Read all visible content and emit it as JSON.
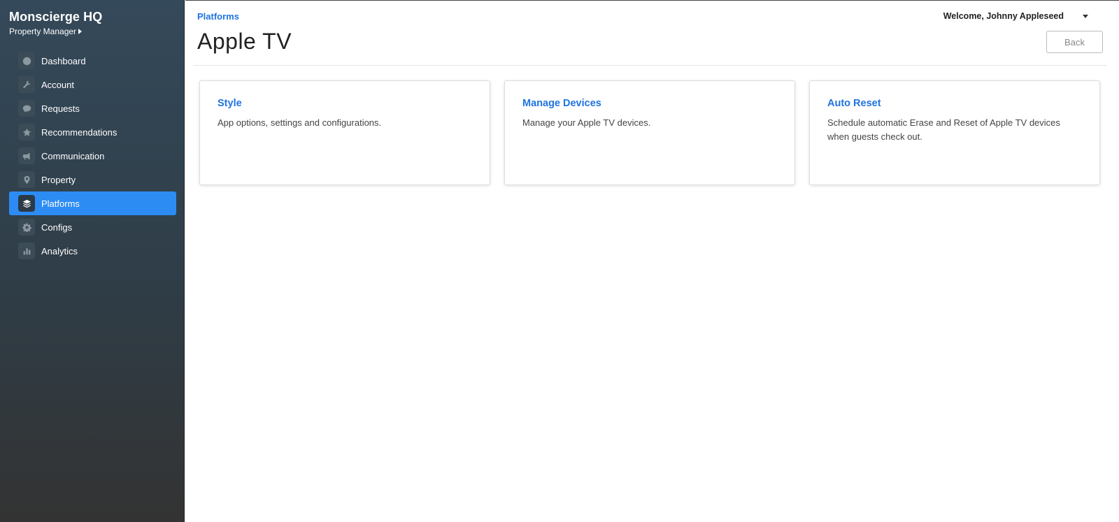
{
  "sidebar": {
    "brand": "Monscierge HQ",
    "role": "Property Manager",
    "items": [
      {
        "label": "Dashboard",
        "icon": "dashboard-icon"
      },
      {
        "label": "Account",
        "icon": "wrench-icon"
      },
      {
        "label": "Requests",
        "icon": "chat-bubble-icon"
      },
      {
        "label": "Recommendations",
        "icon": "star-icon"
      },
      {
        "label": "Communication",
        "icon": "megaphone-icon"
      },
      {
        "label": "Property",
        "icon": "map-pin-icon"
      },
      {
        "label": "Platforms",
        "icon": "layers-icon",
        "active": true
      },
      {
        "label": "Configs",
        "icon": "gear-icon"
      },
      {
        "label": "Analytics",
        "icon": "bar-chart-icon"
      }
    ]
  },
  "header": {
    "breadcrumb": "Platforms",
    "welcome": "Welcome, Johnny Appleseed",
    "title": "Apple TV",
    "back_label": "Back"
  },
  "cards": [
    {
      "title": "Style",
      "description": "App options, settings and configurations."
    },
    {
      "title": "Manage Devices",
      "description": "Manage your Apple TV devices."
    },
    {
      "title": "Auto Reset",
      "description": "Schedule automatic Erase and Reset of Apple TV devices when guests check out."
    }
  ],
  "colors": {
    "accent": "#2c8cf4",
    "link": "#1f74e0",
    "sidebar_top": "#34495a",
    "sidebar_bottom": "#333333"
  }
}
